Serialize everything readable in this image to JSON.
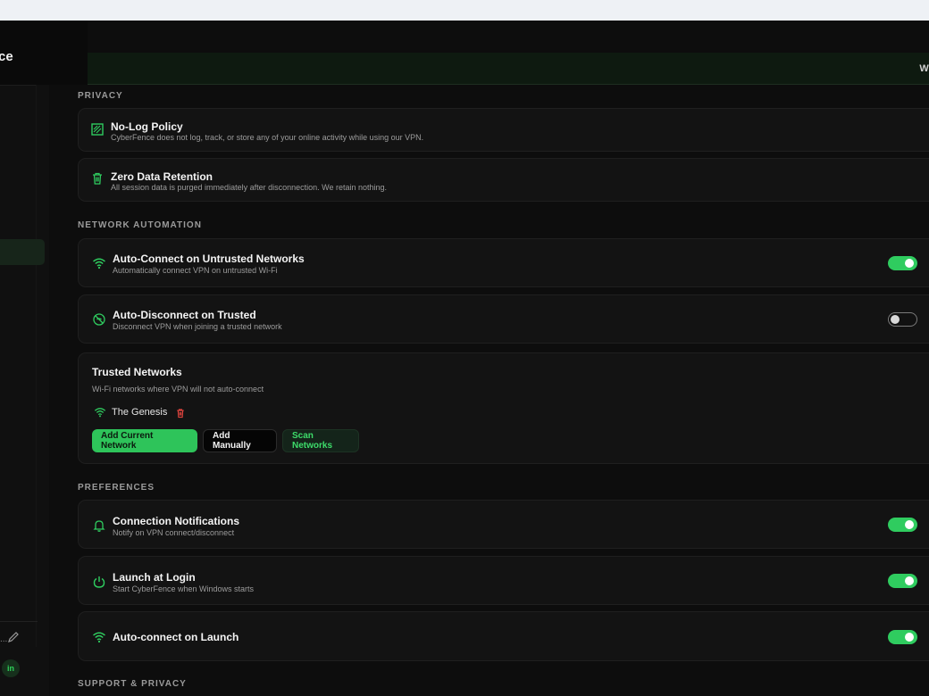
{
  "brand": {
    "title_fragment": "ce"
  },
  "header": {
    "banner_text_fragment": "W"
  },
  "sections": {
    "privacy": "PRIVACY",
    "network_automation": "NETWORK AUTOMATION",
    "preferences": "PREFERENCES",
    "support_privacy": "SUPPORT & PRIVACY"
  },
  "privacy": {
    "no_log": {
      "icon": "document-stripes-icon",
      "title": "No-Log Policy",
      "desc": "CyberFence does not log, track, or store any of your online activity while using our VPN."
    },
    "zero_retention": {
      "icon": "trash-icon",
      "title": "Zero Data Retention",
      "desc": "All session data is purged immediately after disconnection. We retain nothing."
    }
  },
  "automation": {
    "auto_connect_untrusted": {
      "icon": "wifi-icon",
      "title": "Auto-Connect on Untrusted Networks",
      "desc": "Automatically connect VPN on untrusted Wi-Fi",
      "enabled": true
    },
    "auto_disconnect_trusted": {
      "icon": "wifi-off-icon",
      "title": "Auto-Disconnect on Trusted",
      "desc": "Disconnect VPN when joining a trusted network",
      "enabled": false
    },
    "trusted_networks": {
      "title": "Trusted Networks",
      "desc": "Wi-Fi networks where VPN will not auto-connect",
      "networks": [
        {
          "name": "The Genesis"
        }
      ],
      "buttons": {
        "add_current": "Add Current Network",
        "add_manually": "Add Manually",
        "scan": "Scan Networks"
      }
    }
  },
  "preferences": {
    "notifications": {
      "icon": "bell-icon",
      "title": "Connection Notifications",
      "desc": "Notify on VPN connect/disconnect",
      "enabled": true
    },
    "launch_login": {
      "icon": "power-icon",
      "title": "Launch at Login",
      "desc": "Start CyberFence when Windows starts",
      "enabled": true
    },
    "auto_connect_launch": {
      "icon": "wifi-icon",
      "title": "Auto-connect on Launch",
      "enabled": true
    }
  },
  "sidebar_footer": {
    "ellipsis": "...",
    "linkedin": "in"
  },
  "colors": {
    "accent": "#2fcc5f",
    "background": "#0d0d0d",
    "card": "#131313",
    "danger": "#e0443e"
  }
}
